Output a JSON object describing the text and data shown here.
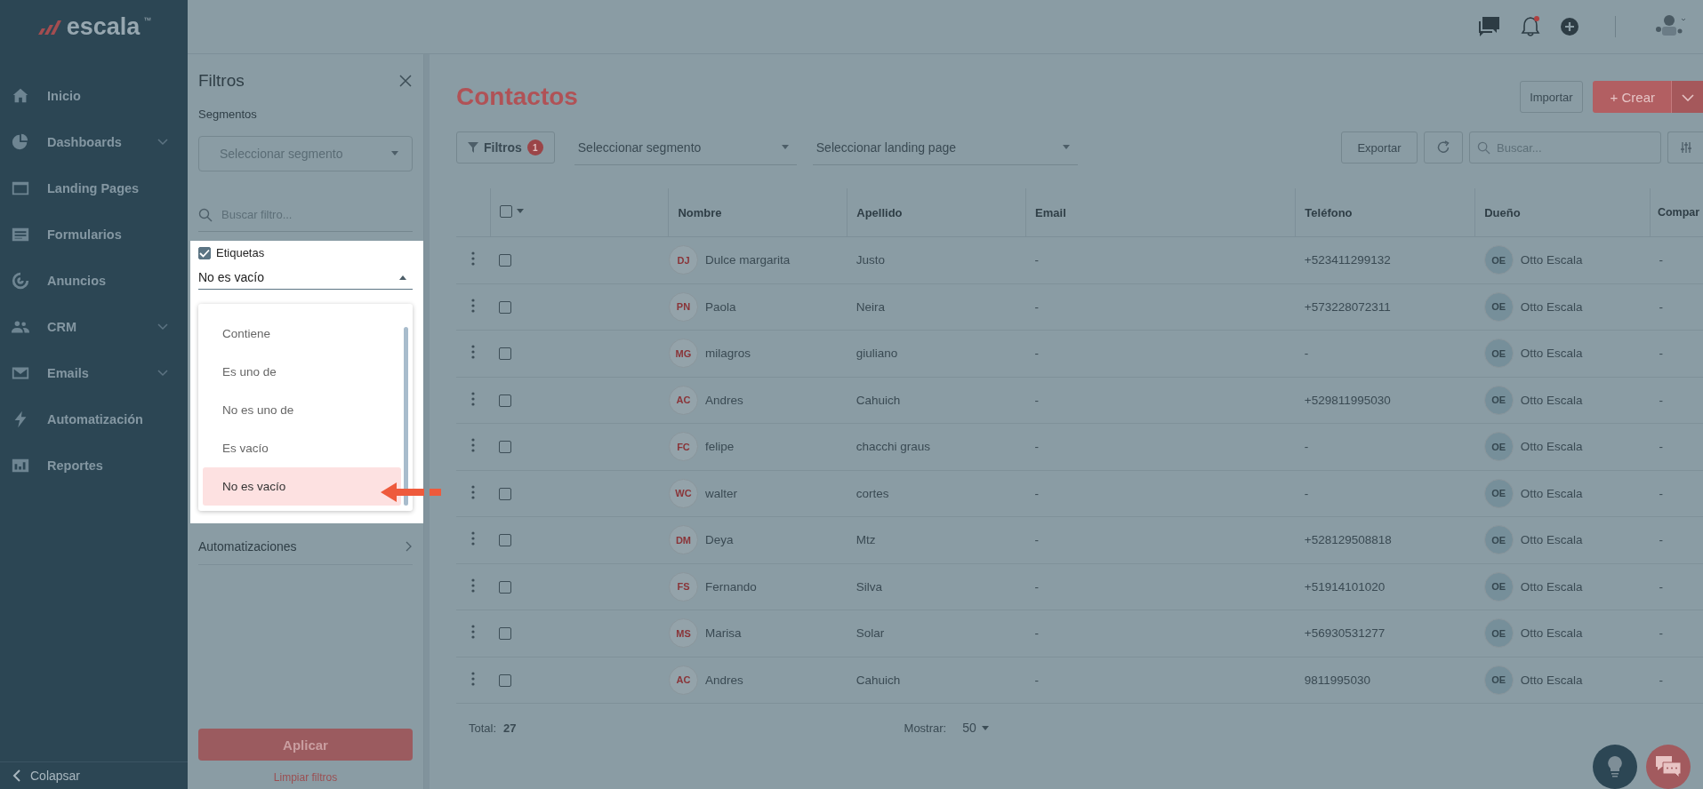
{
  "sidebar": {
    "logo": "escala",
    "trademark": "™",
    "items": [
      {
        "label": "Inicio",
        "kind": "home",
        "expandable": false
      },
      {
        "label": "Dashboards",
        "kind": "pie",
        "expandable": true
      },
      {
        "label": "Landing Pages",
        "kind": "window",
        "expandable": false
      },
      {
        "label": "Formularios",
        "kind": "form",
        "expandable": false
      },
      {
        "label": "Anuncios",
        "kind": "target",
        "expandable": false
      },
      {
        "label": "CRM",
        "kind": "people",
        "expandable": true
      },
      {
        "label": "Emails",
        "kind": "mail",
        "expandable": true
      },
      {
        "label": "Automatización",
        "kind": "bolt",
        "expandable": false
      },
      {
        "label": "Reportes",
        "kind": "chart",
        "expandable": false
      }
    ],
    "collapse": "Colapsar"
  },
  "topbar": {
    "unread_notifications": true
  },
  "filters_panel": {
    "title": "Filtros",
    "segments_label": "Segmentos",
    "segment_placeholder": "Seleccionar segmento",
    "search_placeholder": "Buscar filtro...",
    "tag_filter": {
      "label": "Etiquetas",
      "checked": true,
      "value": "No es vacío",
      "options": [
        {
          "label": "Contiene",
          "selected": false
        },
        {
          "label": "Es uno de",
          "selected": false
        },
        {
          "label": "No es uno de",
          "selected": false
        },
        {
          "label": "Es vacío",
          "selected": false
        },
        {
          "label": "No es vacío",
          "selected": true
        }
      ]
    },
    "groups": [
      {
        "label": "Automatizaciones"
      }
    ],
    "apply": "Aplicar",
    "clear": "Limpiar filtros"
  },
  "page": {
    "title": "Contactos",
    "import": "Importar",
    "create": "Crear",
    "create_icon": "+"
  },
  "toolbar": {
    "filters": "Filtros",
    "filter_count": "1",
    "segment_placeholder": "Seleccionar segmento",
    "landing_placeholder": "Seleccionar landing page",
    "export": "Exportar",
    "search_placeholder": "Buscar..."
  },
  "table": {
    "select_all_checked": false,
    "columns": [
      "Nombre",
      "Apellido",
      "Email",
      "Teléfono",
      "Dueño",
      "Compar"
    ],
    "rows": [
      {
        "checked": false,
        "initials": "DJ",
        "first_name": "Dulce margarita",
        "last_name": "Justo",
        "email": "-",
        "phone": "+523411299132",
        "owner_initials": "OE",
        "owner": "Otto Escala",
        "column_7": "-"
      },
      {
        "checked": false,
        "initials": "PN",
        "first_name": "Paola",
        "last_name": "Neira",
        "email": "-",
        "phone": "+573228072311",
        "owner_initials": "OE",
        "owner": "Otto Escala",
        "column_7": "-"
      },
      {
        "checked": false,
        "initials": "MG",
        "first_name": "milagros",
        "last_name": "giuliano",
        "email": "-",
        "phone": "-",
        "owner_initials": "OE",
        "owner": "Otto Escala",
        "column_7": "-"
      },
      {
        "checked": false,
        "initials": "AC",
        "first_name": "Andres",
        "last_name": "Cahuich",
        "email": "-",
        "phone": "+529811995030",
        "owner_initials": "OE",
        "owner": "Otto Escala",
        "column_7": "-"
      },
      {
        "checked": false,
        "initials": "FC",
        "first_name": "felipe",
        "last_name": "chacchi graus",
        "email": "-",
        "phone": "-",
        "owner_initials": "OE",
        "owner": "Otto Escala",
        "column_7": "-"
      },
      {
        "checked": false,
        "initials": "WC",
        "first_name": "walter",
        "last_name": "cortes",
        "email": "-",
        "phone": "-",
        "owner_initials": "OE",
        "owner": "Otto Escala",
        "column_7": "-"
      },
      {
        "checked": false,
        "initials": "DM",
        "first_name": "Deya",
        "last_name": "Mtz",
        "email": "-",
        "phone": "+528129508818",
        "owner_initials": "OE",
        "owner": "Otto Escala",
        "column_7": "-"
      },
      {
        "checked": false,
        "initials": "FS",
        "first_name": "Fernando",
        "last_name": "Silva",
        "email": "-",
        "phone": "+51914101020",
        "owner_initials": "OE",
        "owner": "Otto Escala",
        "column_7": "-"
      },
      {
        "checked": false,
        "initials": "MS",
        "first_name": "Marisa",
        "last_name": "Solar",
        "email": "-",
        "phone": "+56930531277",
        "owner_initials": "OE",
        "owner": "Otto Escala",
        "column_7": "-"
      },
      {
        "checked": false,
        "initials": "AC",
        "first_name": "Andres",
        "last_name": "Cahuich",
        "email": "-",
        "phone": "9811995030",
        "owner_initials": "OE",
        "owner": "Otto Escala",
        "column_7": "-"
      }
    ]
  },
  "footer": {
    "total_label": "Total:",
    "total": "27",
    "show_label": "Mostrar:",
    "show_value": "50"
  }
}
